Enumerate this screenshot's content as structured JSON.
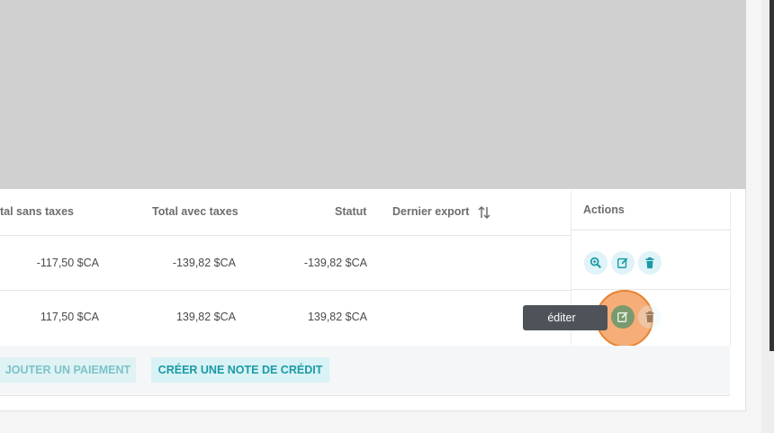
{
  "table": {
    "headers": {
      "total_excl": "tal sans taxes",
      "total_incl": "Total avec taxes",
      "status": "Statut",
      "last_export": "Dernier export",
      "actions": "Actions"
    },
    "rows": [
      {
        "total_excl": "-117,50 $CA",
        "total_incl": "-139,82 $CA",
        "status": "-139,82 $CA",
        "last_export": ""
      },
      {
        "total_excl": "117,50 $CA",
        "total_incl": "139,82 $CA",
        "status": "139,82 $CA",
        "last_export": ""
      }
    ]
  },
  "footer": {
    "add_payment": "JOUTER UN PAIEMENT",
    "create_credit_note": "CRÉER UNE NOTE DE CRÉDIT"
  },
  "tooltip": {
    "text": "éditer"
  },
  "colors": {
    "accent": "#1a9aa5",
    "action_bg": "#dff3f8",
    "overlay": "#d0d0d0",
    "cursor_highlight": "#f4965e",
    "tooltip_bg": "#4d5358"
  },
  "icons": [
    "sort-icon",
    "zoom-in-icon",
    "edit-icon",
    "trash-icon"
  ]
}
